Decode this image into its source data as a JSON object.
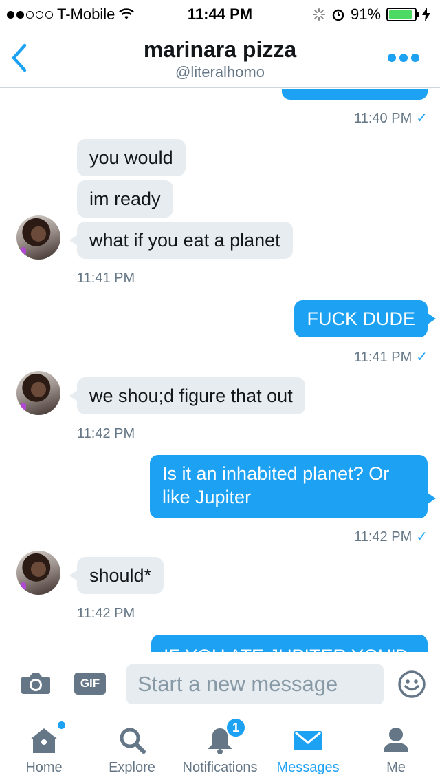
{
  "status_bar": {
    "carrier": "T-Mobile",
    "time": "11:44 PM",
    "battery": "91%",
    "battery_level": 0.91
  },
  "header": {
    "title": "marinara pizza",
    "handle": "@literalhomo",
    "back_icon": "chevron-left-icon",
    "more_icon": "more-dots-icon",
    "accent": "#1da1f2"
  },
  "conversation": {
    "read_mark": "✓",
    "messages": [
      {
        "from": "me",
        "text": "",
        "time": "11:40 PM"
      },
      {
        "from": "them",
        "text": "you would"
      },
      {
        "from": "them",
        "text": "im ready"
      },
      {
        "from": "them",
        "text": "what if you eat a planet",
        "time": "11:41 PM"
      },
      {
        "from": "me",
        "text": "FUCK DUDE",
        "time": "11:41 PM"
      },
      {
        "from": "them",
        "text": "we shou;d figure that out",
        "time": "11:42 PM"
      },
      {
        "from": "me",
        "text": "Is it an inhabited planet? Or like Jupiter",
        "time": "11:42 PM"
      },
      {
        "from": "them",
        "text": "should*",
        "time": "11:42 PM"
      },
      {
        "from": "me",
        "text": "IF YOU ATE JUPITER YOU'D"
      }
    ]
  },
  "composer": {
    "placeholder": "Start a new message",
    "gif_label": "GIF",
    "camera_icon": "camera-icon",
    "emoji_icon": "emoji-icon"
  },
  "tabbar": {
    "tabs": [
      {
        "label": "Home",
        "icon": "home-icon",
        "has_dot": true
      },
      {
        "label": "Explore",
        "icon": "search-icon"
      },
      {
        "label": "Notifications",
        "icon": "bell-icon",
        "badge": "1"
      },
      {
        "label": "Messages",
        "icon": "envelope-icon",
        "active": true
      },
      {
        "label": "Me",
        "icon": "person-icon"
      }
    ]
  }
}
